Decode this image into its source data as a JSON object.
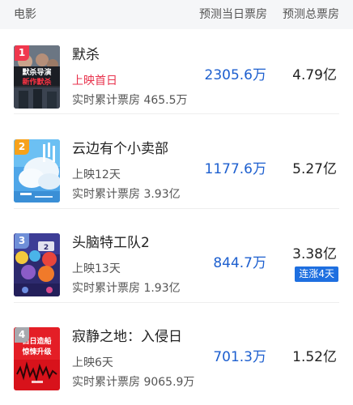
{
  "header": {
    "movie_label": "电影",
    "daily_label": "预测当日票房",
    "total_label": "预测总票房"
  },
  "colors": {
    "accent_blue": "#1d5fcf",
    "badge_blue": "#1e6fe0",
    "first_day_red": "#e8324c",
    "rank1": "#f0384e",
    "rank2": "#f7a21b",
    "rank3": "#6f8fd8",
    "rank4": "#a7a9ae"
  },
  "movies": [
    {
      "rank": "1",
      "title": "默杀",
      "release": "上映首日",
      "cumulative": "实时累计票房 465.5万",
      "daily": "2305.6万",
      "total": "4.79亿",
      "poster_text": [
        "默杀导演",
        "新作默杀"
      ]
    },
    {
      "rank": "2",
      "title": "云边有个小卖部",
      "release": "上映12天",
      "cumulative": "实时累计票房 3.93亿",
      "daily": "1177.6万",
      "total": "5.27亿"
    },
    {
      "rank": "3",
      "title": "头脑特工队2",
      "release": "上映13天",
      "cumulative": "实时累计票房 1.93亿",
      "daily": "844.7万",
      "total": "3.38亿",
      "badge": "连涨4天"
    },
    {
      "rank": "4",
      "title": "寂静之地：入侵日",
      "release": "上映6天",
      "cumulative": "实时累计票房 9065.9万",
      "daily": "701.3万",
      "total": "1.52亿",
      "poster_text": [
        "白日造船",
        "惊悚升级"
      ]
    }
  ]
}
